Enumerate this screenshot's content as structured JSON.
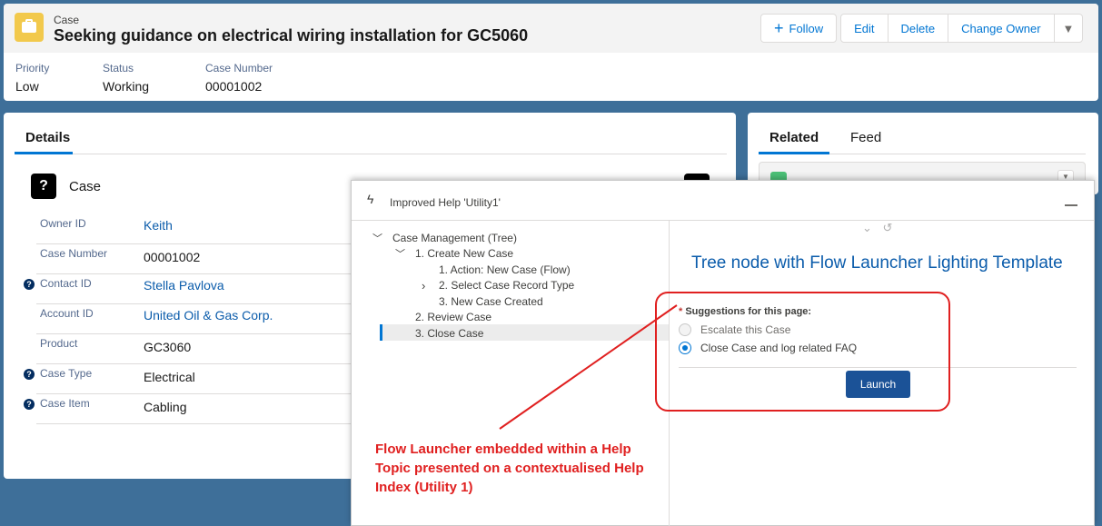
{
  "header": {
    "object_label": "Case",
    "title": "Seeking guidance on electrical wiring installation for GC5060",
    "buttons": {
      "follow": "Follow",
      "edit": "Edit",
      "delete": "Delete",
      "change_owner": "Change Owner"
    },
    "highlights": [
      {
        "label": "Priority",
        "value": "Low"
      },
      {
        "label": "Status",
        "value": "Working"
      },
      {
        "label": "Case Number",
        "value": "00001002"
      }
    ]
  },
  "details": {
    "tab": "Details",
    "section_title": "Case",
    "fields": [
      {
        "label": "Owner ID",
        "value": "Keith",
        "link": true,
        "help": false
      },
      {
        "label": "Case Number",
        "value": "00001002",
        "link": false,
        "help": false
      },
      {
        "label": "Contact ID",
        "value": "Stella Pavlova",
        "link": true,
        "help": true
      },
      {
        "label": "Account ID",
        "value": "United Oil & Gas Corp.",
        "link": true,
        "help": false
      },
      {
        "label": "Product",
        "value": "GC3060",
        "link": false,
        "help": false
      },
      {
        "label": "Case Type",
        "value": "Electrical",
        "link": false,
        "help": true
      },
      {
        "label": "Case Item",
        "value": "Cabling",
        "link": false,
        "help": true
      }
    ]
  },
  "related": {
    "tabs": [
      "Related",
      "Feed"
    ]
  },
  "utility": {
    "title": "Improved Help 'Utility1'",
    "tree": [
      "Case Management (Tree)",
      "1. Create New Case",
      "1. Action: New Case (Flow)",
      "2. Select Case Record Type",
      "3. New Case Created",
      "2. Review Case",
      "3. Close Case"
    ],
    "topic_title": "Tree node with Flow Launcher Lighting Template",
    "flow": {
      "label": "Suggestions for this page:",
      "required_mark": "*",
      "options": [
        "Escalate this Case",
        "Close Case and log related FAQ"
      ],
      "selected_index": 1,
      "launch": "Launch"
    }
  },
  "annotation": {
    "text": "Flow Launcher embedded within a Help Topic presented on a contextualised Help Index (Utility 1)",
    "color": "#e02020"
  }
}
